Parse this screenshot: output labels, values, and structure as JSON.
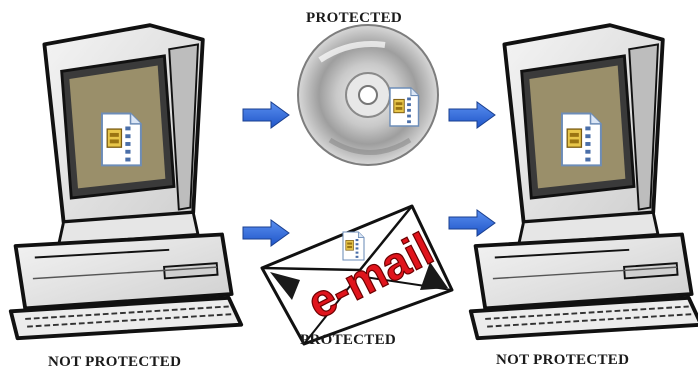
{
  "labels": {
    "disc_status": "PROTECTED",
    "email_status": "PROTECTED",
    "sender_status": "NOT PROTECTED",
    "receiver_status": "NOT PROTECTED"
  },
  "email_word": "e-mail",
  "colors": {
    "arrow": "#2f6fe0",
    "screen": "#9a8f6a",
    "email_text": "#e0141c",
    "disc": "#b9b9b9"
  },
  "icons": [
    "computer-icon",
    "cd-disc-icon",
    "envelope-icon",
    "zip-file-icon",
    "arrow-right-icon"
  ]
}
